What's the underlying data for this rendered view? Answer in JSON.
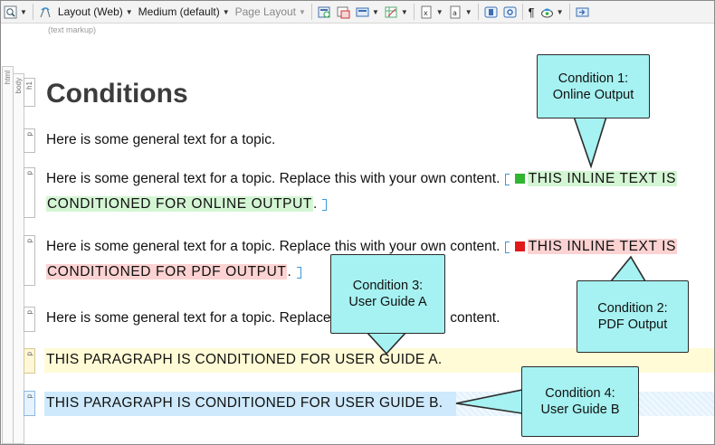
{
  "toolbar": {
    "layout_label": "Layout (Web)",
    "medium_label": "Medium (default)",
    "page_layout_label": "Page Layout",
    "paragraph_mark": "¶"
  },
  "markup_hint": "(text markup)",
  "structure": {
    "html_label": "html",
    "body_label": "body",
    "h1_tag": "h1",
    "p_tag": "p"
  },
  "content": {
    "heading": "Conditions",
    "para1": "Here is some general text for a topic.",
    "para2_text": "Here is some general text for a topic. Replace this with your own content.",
    "para2_cond_line1": "THIS INLINE TEXT IS",
    "para2_cond_line2": "CONDITIONED FOR ONLINE OUTPUT",
    "para3_text": "Here is some general text for a topic. Replace this with your own content.",
    "para3_cond_line1": "THIS INLINE TEXT IS",
    "para3_cond_line2": "CONDITIONED FOR PDF OUTPUT",
    "para4_text": "Here is some general text for a topic. Replace this with your own content.",
    "para5": "THIS PARAGRAPH IS CONDITIONED FOR USER GUIDE A.",
    "para6": "THIS PARAGRAPH IS CONDITIONED FOR USER GUIDE B.",
    "period": "."
  },
  "callouts": {
    "c1_line1": "Condition 1:",
    "c1_line2": "Online Output",
    "c2_line1": "Condition 2:",
    "c2_line2": "PDF Output",
    "c3_line1": "Condition 3:",
    "c3_line2": "User Guide A",
    "c4_line1": "Condition 4:",
    "c4_line2": "User Guide B"
  },
  "colors": {
    "online_tag": "#2fb52f",
    "pdf_tag": "#e01a1a",
    "online_highlight": "#d4f5d4",
    "pdf_highlight": "#fcd2d2",
    "guide_a_highlight": "#fffbd6",
    "guide_b_highlight": "#cde9fb",
    "callout_fill": "#a6f1f1"
  },
  "icons": [
    "zoom-icon",
    "show-tags-icon",
    "layout-icon",
    "preview-icon",
    "insert-image-icon",
    "table-icon",
    "variable-icon",
    "snippet-icon",
    "text-box-icon",
    "insert-link-icon",
    "condition-icon",
    "markers-icon",
    "print-icon"
  ]
}
